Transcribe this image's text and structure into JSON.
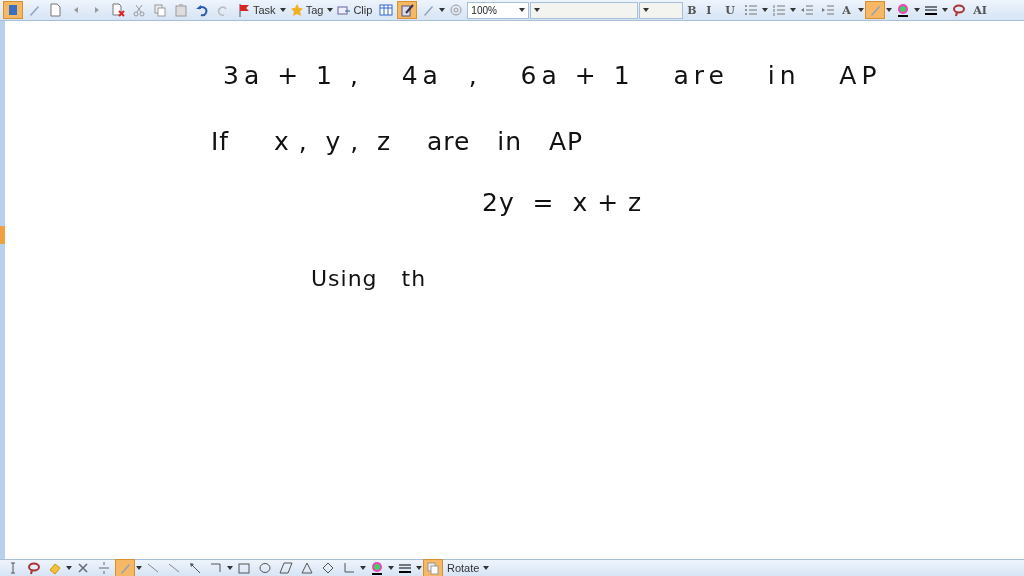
{
  "top_toolbar": [
    {
      "kind": "select",
      "selected": true
    },
    {
      "kind": "pen",
      "selected": false
    },
    {
      "kind": "page",
      "selected": false
    },
    {
      "kind": "back",
      "selected": false
    },
    {
      "kind": "forward",
      "selected": false
    },
    {
      "kind": "delete-page",
      "selected": false
    },
    {
      "kind": "cut",
      "selected": false
    },
    {
      "kind": "copy",
      "selected": false
    },
    {
      "kind": "paste",
      "selected": false
    },
    {
      "kind": "undo",
      "selected": false
    },
    {
      "kind": "redo",
      "selected": false
    },
    {
      "kind": "flag",
      "label": "Task",
      "dropdown": true,
      "selected": false
    },
    {
      "kind": "star",
      "label": "Tag",
      "dropdown": true,
      "selected": false
    },
    {
      "kind": "clip",
      "label": "Clip",
      "selected": false
    },
    {
      "kind": "table",
      "selected": false
    },
    {
      "kind": "ink",
      "selected": true
    },
    {
      "kind": "pen",
      "dropdown": true,
      "selected": false
    },
    {
      "kind": "at",
      "selected": false
    },
    {
      "kind": "zoom",
      "value": "100%"
    },
    {
      "kind": "font"
    },
    {
      "kind": "size"
    },
    {
      "kind": "text",
      "label": "B",
      "selected": false
    },
    {
      "kind": "text",
      "label": "I",
      "selected": false
    },
    {
      "kind": "text",
      "label": "U",
      "selected": false
    },
    {
      "kind": "bullets",
      "dropdown": true,
      "selected": false
    },
    {
      "kind": "numbers",
      "dropdown": true,
      "selected": false
    },
    {
      "kind": "outdent",
      "selected": false
    },
    {
      "kind": "indent",
      "selected": false
    },
    {
      "kind": "text",
      "label": "A",
      "dropdown": true,
      "selected": false
    },
    {
      "kind": "pen",
      "dropdown": true,
      "selected": true
    },
    {
      "kind": "color",
      "dropdown": true,
      "selected": false
    },
    {
      "kind": "weight",
      "dropdown": true,
      "selected": false
    },
    {
      "kind": "lasso",
      "selected": false
    },
    {
      "kind": "text",
      "label": "AI",
      "selected": false
    }
  ],
  "page_lines": [
    {
      "kind": "heading",
      "text": "3a + 1 ,   4a  ,   6a + 1   are   in   AP"
    },
    {
      "kind": "statement",
      "text": "If     x ,  y ,  z    are   in   AP"
    },
    {
      "kind": "formula",
      "text": "2y  =  x + z"
    },
    {
      "kind": "step",
      "text": "Using   th"
    }
  ],
  "bottom_toolbar": [
    {
      "kind": "caret",
      "selected": false
    },
    {
      "kind": "lasso",
      "selected": false
    },
    {
      "kind": "eraser",
      "dropdown": true,
      "selected": false
    },
    {
      "kind": "cross",
      "selected": false
    },
    {
      "kind": "divide",
      "selected": false
    },
    {
      "kind": "pen",
      "dropdown": true,
      "selected": true
    },
    {
      "kind": "line",
      "selected": false
    },
    {
      "kind": "line",
      "selected": false
    },
    {
      "kind": "arrow",
      "selected": false
    },
    {
      "kind": "elbow",
      "dropdown": true,
      "selected": false
    },
    {
      "kind": "rect",
      "selected": false
    },
    {
      "kind": "ellipse",
      "selected": false
    },
    {
      "kind": "parallelogram",
      "selected": false
    },
    {
      "kind": "triangle",
      "selected": false
    },
    {
      "kind": "diamond",
      "selected": false
    },
    {
      "kind": "axes",
      "dropdown": true,
      "selected": false
    },
    {
      "kind": "color",
      "dropdown": true,
      "selected": false
    },
    {
      "kind": "weight",
      "dropdown": true,
      "selected": false
    },
    {
      "kind": "copy",
      "selected": true
    },
    {
      "kind": "none",
      "label": "Rotate",
      "dropdown": true,
      "selected": false
    }
  ]
}
